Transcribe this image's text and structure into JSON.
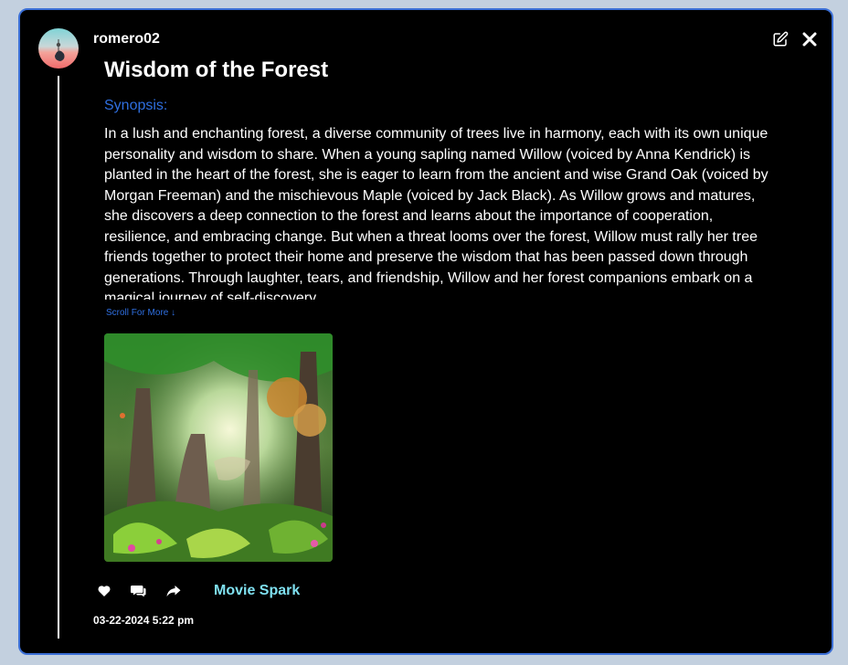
{
  "post": {
    "username": "romero02",
    "title": "Wisdom of the Forest",
    "synopsis_label": "Synopsis:",
    "synopsis": "In a lush and enchanting forest, a diverse community of trees live in harmony, each with its own unique personality and wisdom to share. When a young sapling named Willow (voiced by Anna Kendrick) is planted in the heart of the forest, she is eager to learn from the ancient and wise Grand Oak (voiced by Morgan Freeman) and the mischievous Maple (voiced by Jack Black). As Willow grows and matures, she discovers a deep connection to the forest and learns about the importance of cooperation, resilience, and embracing change. But when a threat looms over the forest, Willow must rally her tree friends together to protect their home and preserve the wisdom that has been passed down through generations. Through laughter, tears, and friendship, Willow and her forest companions embark on a magical journey of self-discovery",
    "scroll_more": "Scroll For More ↓",
    "spark_label": "Movie Spark",
    "timestamp": "03-22-2024 5:22 pm"
  },
  "icons": {
    "edit": "edit-icon",
    "close": "close-icon",
    "like": "heart-icon",
    "comment": "comment-icon",
    "share": "share-icon"
  },
  "colors": {
    "page_background": "#c3d0df",
    "modal_background": "#000000",
    "modal_border": "#3b6fd6",
    "accent_blue": "#2f6fe0",
    "spark_cyan": "#7fe0f0"
  }
}
